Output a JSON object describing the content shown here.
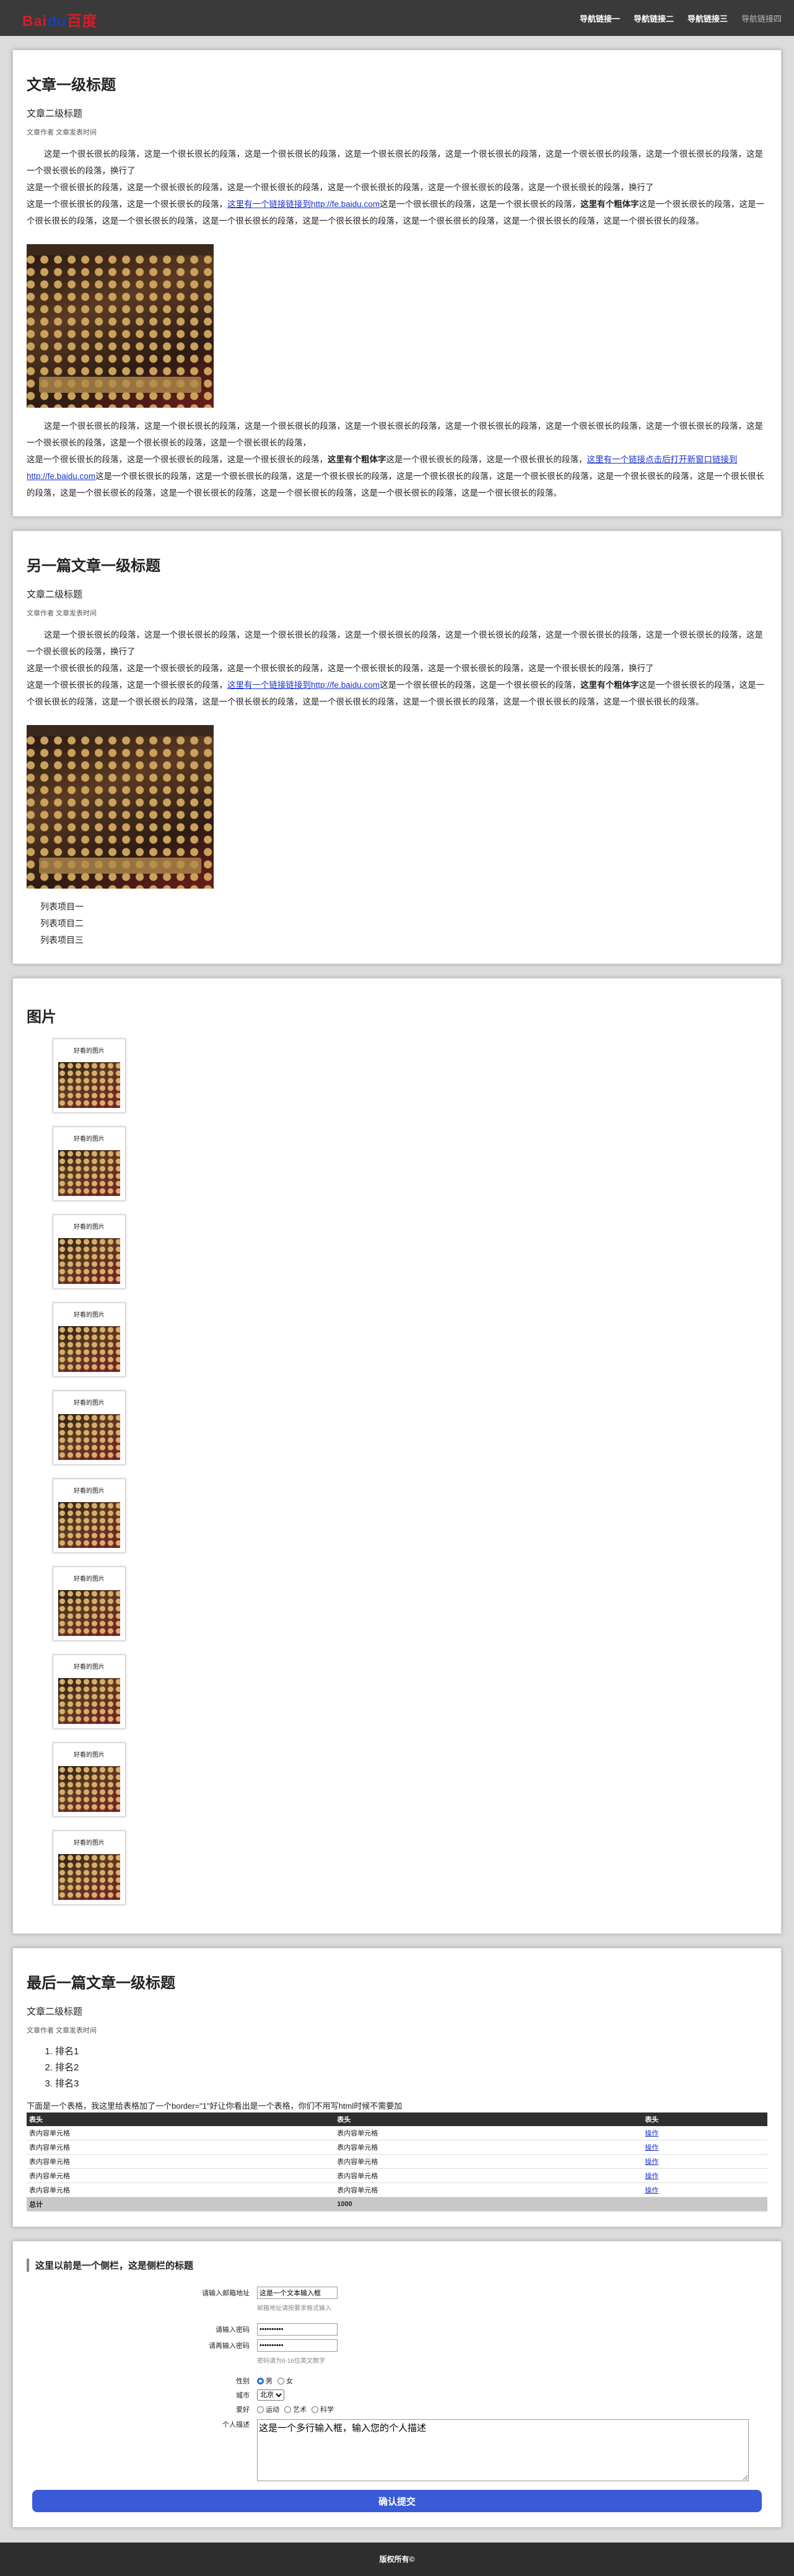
{
  "header": {
    "logo_part1": "Bai",
    "logo_part2": "du",
    "logo_part3": "百度",
    "nav": [
      "导航链接一",
      "导航链接二",
      "导航链接三",
      "导航链接四"
    ]
  },
  "article1": {
    "h1": "文章一级标题",
    "h2": "文章二级标题",
    "meta": "文章作者 文章发表时间",
    "p1": "这是一个很长很长的段落，这是一个很长很长的段落，这是一个很长很长的段落，这是一个很长很长的段落，这是一个很长很长的段落，这是一个很长很长的段落，这是一个很长很长的段落，这是一个很长很长的段落，换行了",
    "p2": "这是一个很长很长的段落，这是一个很长很长的段落，这是一个很长很长的段落，这是一个很长很长的段落，这是一个很长很长的段落，这是一个很长很长的段落，换行了",
    "p3_pre": "这是一个很长很长的段落，这是一个很长很长的段落，",
    "p3_link": "这里有一个链接链接到http://fe.baidu.com",
    "p3_mid": "这是一个很长很长的段落，这是一个很长很长的段落，",
    "p3_bold": "这里有个粗体字",
    "p3_post": "这是一个很长很长的段落，这是一个很长很长的段落，这是一个很长很长的段落，这是一个很长很长的段落，这是一个很长很长的段落，这是一个很长很长的段落，这是一个很长很长的段落，这是一个很长很长的段落。",
    "p4_pre": "这是一个很长很长的段落，这是一个很长很长的段落，这是一个很长很长的段落，这是一个很长很长的段落，这是一个很长很长的段落，这是一个很长很长的段落，这是一个很长很长的段落，这是一个很长很长的段落，这是一个很长很长的段落，这是一个很长很长的段落，",
    "p5_pre": "这是一个很长很长的段落，这是一个很长很长的段落，这是一个很长很长的段落，",
    "p5_bold": "这里有个粗体字",
    "p5_mid": "这是一个很长很长的段落，这是一个很长很长的段落，",
    "p5_link": "这里有一个链接点击后打开新窗口链接到http://fe.baidu.com",
    "p5_post": "这是一个很长很长的段落，这是一个很长很长的段落，这是一个很长很长的段落，这是一个很长很长的段落，这是一个很长很长的段落，这是一个很长很长的段落，这是一个很长很长的段落，这是一个很长很长的段落，这是一个很长很长的段落，这是一个很长很长的段落，这是一个很长很长的段落，这是一个很长很长的段落。"
  },
  "article2": {
    "h1": "另一篇文章一级标题",
    "h2": "文章二级标题",
    "meta": "文章作者 文章发表时间",
    "p1": "这是一个很长很长的段落，这是一个很长很长的段落，这是一个很长很长的段落，这是一个很长很长的段落，这是一个很长很长的段落，这是一个很长很长的段落，这是一个很长很长的段落，这是一个很长很长的段落，换行了",
    "p2": "这是一个很长很长的段落，这是一个很长很长的段落，这是一个很长很长的段落，这是一个很长很长的段落，这是一个很长很长的段落，这是一个很长很长的段落，换行了",
    "p3_pre": "这是一个很长很长的段落，这是一个很长很长的段落，",
    "p3_link": "这里有一个链接链接到http://fe.baidu.com",
    "p3_mid": "这是一个很长很长的段落，这是一个很长很长的段落，",
    "p3_bold": "这里有个粗体字",
    "p3_post": "这是一个很长很长的段落，这是一个很长很长的段落，这是一个很长很长的段落，这是一个很长很长的段落，这是一个很长很长的段落，这是一个很长很长的段落，这是一个很长很长的段落，这是一个很长很长的段落。",
    "list": [
      "列表项目一",
      "列表项目二",
      "列表项目三"
    ]
  },
  "gallery": {
    "title": "图片",
    "caption": "好看的图片",
    "count": 10
  },
  "article3": {
    "h1": "最后一篇文章一级标题",
    "h2": "文章二级标题",
    "meta": "文章作者 文章发表时间",
    "ranks": [
      "排名1",
      "排名2",
      "排名3"
    ],
    "table_note": "下面是一个表格，我这里给表格加了一个border=\"1\"好让你看出是一个表格，你们不用写html时候不需要加",
    "headers": [
      "表头",
      "表头",
      "表头"
    ],
    "rows": [
      [
        "表内容单元格",
        "表内容单元格",
        "操作"
      ],
      [
        "表内容单元格",
        "表内容单元格",
        "操作"
      ],
      [
        "表内容单元格",
        "表内容单元格",
        "操作"
      ],
      [
        "表内容单元格",
        "表内容单元格",
        "操作"
      ],
      [
        "表内容单元格",
        "表内容单元格",
        "操作"
      ]
    ],
    "footer_row": [
      "总计",
      "1000",
      ""
    ]
  },
  "form": {
    "title": "这里以前是一个侧栏，这是侧栏的标题",
    "email_label": "请输入邮箱地址",
    "email_value": "这是一个文本输入框",
    "email_hint": "邮箱地址请按要求格式输入",
    "pwd_label": "请输入密码",
    "pwd_value": "••••••••••",
    "pwd2_label": "请再输入密码",
    "pwd2_value": "••••••••••",
    "pwd_hint": "密码请为6-16位英文数字",
    "gender_label": "性别",
    "gender_options": [
      "男",
      "女"
    ],
    "city_label": "城市",
    "city_value": "北京",
    "hobby_label": "爱好",
    "hobby_options": [
      "运动",
      "艺术",
      "科学"
    ],
    "desc_label": "个人描述",
    "desc_value": "这是一个多行输入框，输入您的个人描述",
    "submit": "确认提交"
  },
  "footer": {
    "text": "版权所有©"
  }
}
